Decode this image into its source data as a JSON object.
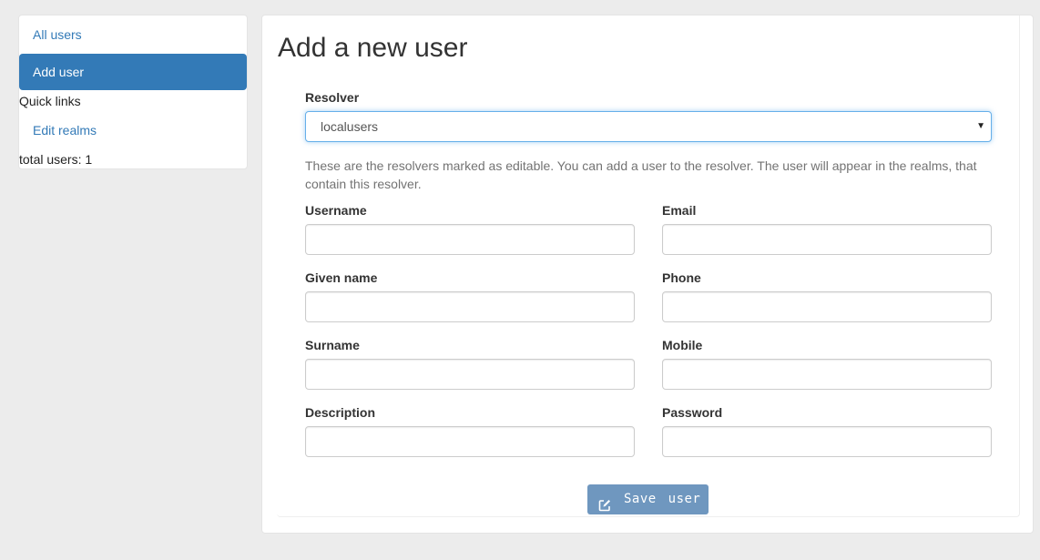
{
  "sidebar": {
    "all_users": "All users",
    "add_user": "Add user",
    "quick_links": "Quick links",
    "edit_realms": "Edit realms",
    "total_users": "total users: 1"
  },
  "main": {
    "title": "Add a new user",
    "resolver_label": "Resolver",
    "resolver_value": "localusers",
    "help_text": "These are the resolvers marked as editable. You can add a user to the resolver. The user will appear in the realms, that contain this resolver.",
    "fields": {
      "username": "Username",
      "email": "Email",
      "given_name": "Given name",
      "phone": "Phone",
      "surname": "Surname",
      "mobile": "Mobile",
      "description": "Description",
      "password": "Password"
    },
    "save_button": "Save user",
    "save_icon": "edit-icon"
  },
  "colors": {
    "accent": "#337ab7",
    "button": "#6f97bf"
  }
}
